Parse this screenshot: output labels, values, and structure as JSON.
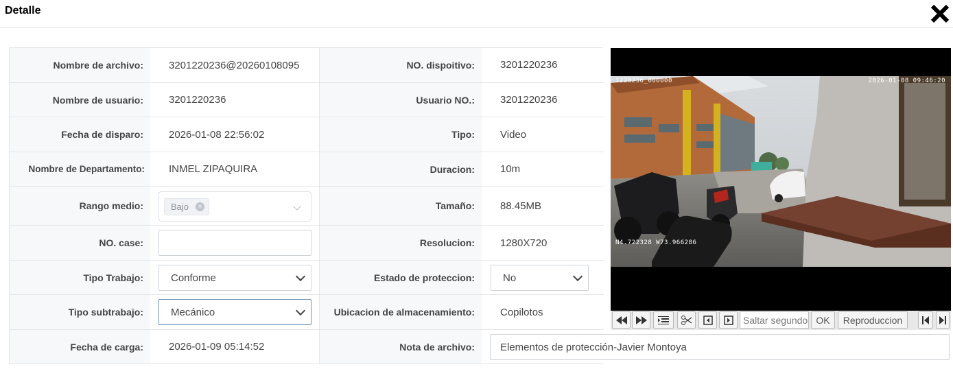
{
  "dialog": {
    "title": "Detalle"
  },
  "fields": {
    "nombre_archivo": {
      "label": "Nombre de archivo:",
      "value": "3201220236@20260108095"
    },
    "no_dispositivo": {
      "label": "NO. dispoitivo:",
      "value": "3201220236"
    },
    "nombre_usuario": {
      "label": "Nombre de usuario:",
      "value": "3201220236"
    },
    "usuario_no": {
      "label": "Usuario NO.:",
      "value": "3201220236"
    },
    "fecha_disparo": {
      "label": "Fecha de disparo:",
      "value": "2026-01-08 22:56:02"
    },
    "tipo": {
      "label": "Tipo:",
      "value": "Video"
    },
    "departamento": {
      "label": "Nombre de Departamento:",
      "value": "INMEL ZIPAQUIRA"
    },
    "duracion": {
      "label": "Duracion:",
      "value": "10m"
    },
    "rango_medio": {
      "label": "Rango medio:",
      "tag": "Bajo"
    },
    "tamano": {
      "label": "Tamaño:",
      "value": "88.45MB"
    },
    "no_case": {
      "label": "NO. case:",
      "value": ""
    },
    "resolucion": {
      "label": "Resolucion:",
      "value": "1280X720"
    },
    "tipo_trabajo": {
      "label": "Tipo Trabajo:",
      "value": "Conforme"
    },
    "estado_proteccion": {
      "label": "Estado de proteccion:",
      "value": "No"
    },
    "tipo_subtrabajo": {
      "label": "Tipo subtrabajo:",
      "value": "Mecánico"
    },
    "ubicacion": {
      "label": "Ubicacion de almacenamiento:",
      "value": "Copilotos"
    },
    "fecha_carga": {
      "label": "Fecha de carga:",
      "value": "2026-01-09 05:14:52"
    },
    "nota_archivo": {
      "label": "Nota de archivo:",
      "value": "Elementos de protección-Javier Montoya"
    }
  },
  "video": {
    "osd_device": "1220236_000000",
    "osd_datetime": "2026-01-08 09:46:20",
    "osd_coords": "N4.722328  W73.966286"
  },
  "player_controls": {
    "seek_placeholder": "Saltar segundo",
    "ok_label": "OK",
    "play_label": "Reproduccion"
  },
  "icons": {
    "close": "close-icon",
    "rewind": "rewind-icon",
    "fast_forward": "fast-forward-icon",
    "list": "list-icon",
    "cut": "scissors-icon",
    "prev_frame": "prev-frame-icon",
    "next_frame": "next-frame-icon",
    "skip_start": "skip-start-icon",
    "skip_end": "skip-end-icon"
  }
}
